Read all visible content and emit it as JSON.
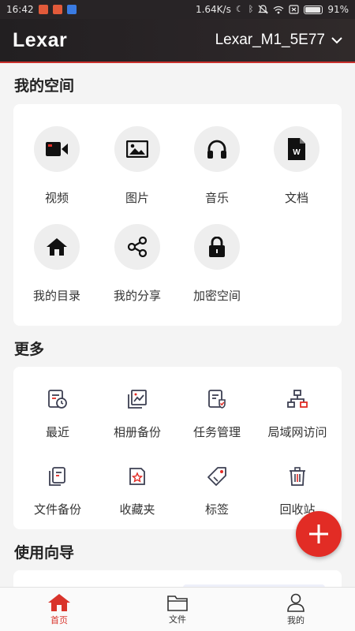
{
  "status_bar": {
    "time": "16:42",
    "speed": "1.64K/s",
    "battery": "91%",
    "battery_level": 0.91
  },
  "header": {
    "logo": "Lexar",
    "device_name": "Lexar_M1_5E77"
  },
  "my_space": {
    "title": "我的空间",
    "items": [
      {
        "label": "视频",
        "icon": "video-icon"
      },
      {
        "label": "图片",
        "icon": "image-icon"
      },
      {
        "label": "音乐",
        "icon": "headphones-icon"
      },
      {
        "label": "文档",
        "icon": "document-icon"
      },
      {
        "label": "我的目录",
        "icon": "home-icon"
      },
      {
        "label": "我的分享",
        "icon": "share-icon"
      },
      {
        "label": "加密空间",
        "icon": "lock-icon"
      }
    ]
  },
  "more": {
    "title": "更多",
    "items": [
      {
        "label": "最近",
        "icon": "recent-icon"
      },
      {
        "label": "相册备份",
        "icon": "album-backup-icon"
      },
      {
        "label": "任务管理",
        "icon": "task-icon"
      },
      {
        "label": "局域网访问",
        "icon": "lan-icon"
      },
      {
        "label": "文件备份",
        "icon": "file-backup-icon"
      },
      {
        "label": "收藏夹",
        "icon": "favorites-icon"
      },
      {
        "label": "标签",
        "icon": "tag-icon"
      },
      {
        "label": "回收站",
        "icon": "trash-icon"
      }
    ]
  },
  "guide": {
    "title": "使用向导"
  },
  "bottom_nav": [
    {
      "label": "首页",
      "icon": "home-icon"
    },
    {
      "label": "文件",
      "icon": "folder-icon"
    },
    {
      "label": "我的",
      "icon": "user-icon"
    }
  ],
  "colors": {
    "accent": "#e22c25",
    "header_bg": "#262224"
  }
}
